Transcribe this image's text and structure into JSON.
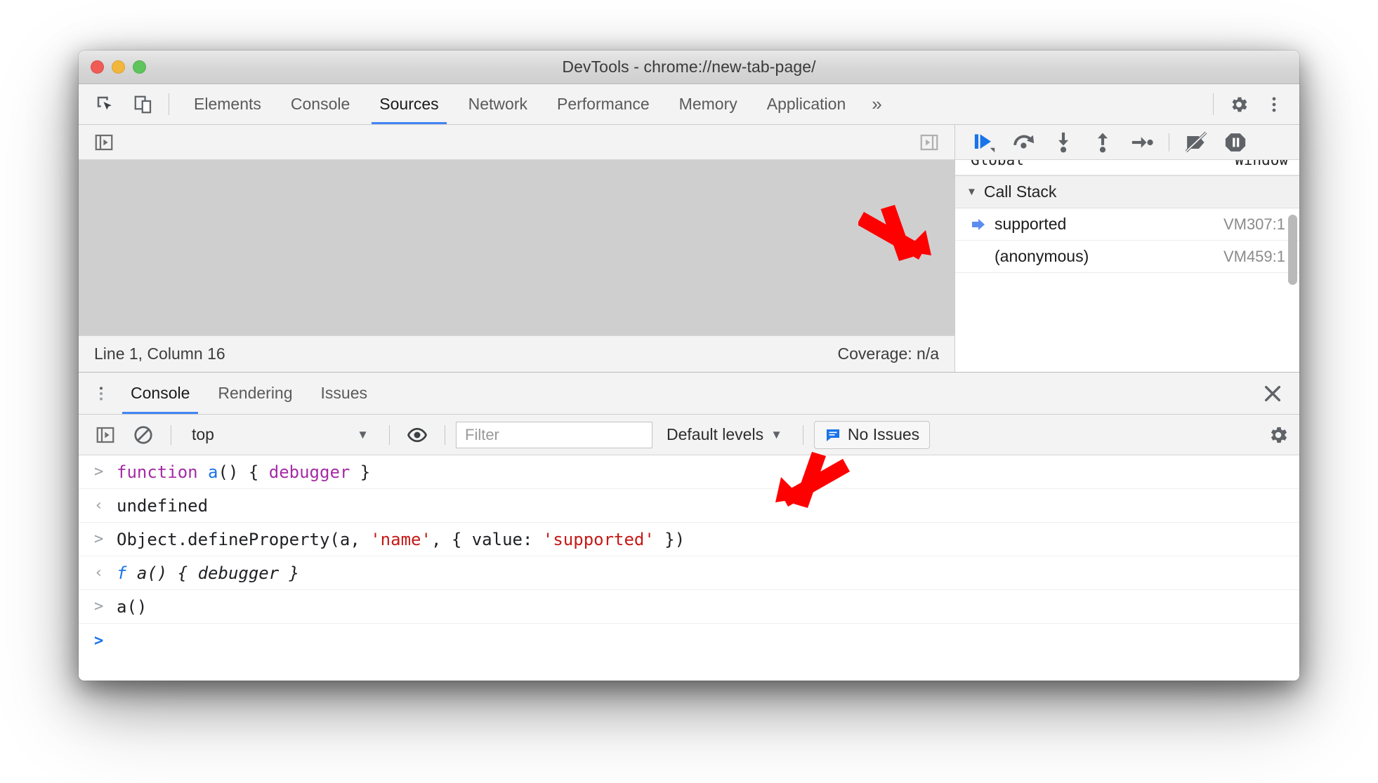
{
  "window": {
    "title": "DevTools - chrome://new-tab-page/",
    "traffic_lights": [
      "close-red",
      "minimize-yellow",
      "maximize-green"
    ]
  },
  "main_tabs": {
    "icons": [
      "inspect-element-icon",
      "device-toolbar-icon"
    ],
    "items": [
      {
        "label": "Elements",
        "active": false
      },
      {
        "label": "Console",
        "active": false
      },
      {
        "label": "Sources",
        "active": true
      },
      {
        "label": "Network",
        "active": false
      },
      {
        "label": "Performance",
        "active": false
      },
      {
        "label": "Memory",
        "active": false
      },
      {
        "label": "Application",
        "active": false
      }
    ],
    "more_label": "»",
    "settings_icon": "gear-icon",
    "menu_icon": "kebab-menu-icon"
  },
  "sources": {
    "toolbar": {
      "show_navigator_icon": "show-navigator-panel-icon",
      "show_debugger_icon": "show-debugger-panel-icon"
    },
    "status": {
      "cursor": "Line 1, Column 16",
      "coverage": "Coverage: n/a"
    }
  },
  "debugger": {
    "buttons": [
      {
        "name": "resume-script-execution",
        "active": true
      },
      {
        "name": "step-over-next-function-call",
        "active": false
      },
      {
        "name": "step-into-next-function-call",
        "active": false
      },
      {
        "name": "step-out-of-current-function",
        "active": false
      },
      {
        "name": "step",
        "active": false
      },
      {
        "name": "deactivate-breakpoints",
        "active": false
      },
      {
        "name": "pause-on-exceptions",
        "active": false
      }
    ],
    "scope_clipped": {
      "left": "Global",
      "right": "Window"
    },
    "call_stack": {
      "title": "Call Stack",
      "expanded": true,
      "frames": [
        {
          "name": "supported",
          "location": "VM307:1",
          "current": true
        },
        {
          "name": "(anonymous)",
          "location": "VM459:1",
          "current": false
        }
      ]
    }
  },
  "drawer": {
    "tabs": [
      {
        "label": "Console",
        "active": true
      },
      {
        "label": "Rendering",
        "active": false
      },
      {
        "label": "Issues",
        "active": false
      }
    ],
    "menu_icon": "kebab-menu-icon",
    "close_icon": "close-icon",
    "console_toolbar": {
      "sidebar_icon": "console-sidebar-icon",
      "clear_icon": "clear-console-icon",
      "context_value": "top",
      "context_caret": "▼",
      "eye_icon": "live-expression-eye-icon",
      "filter_placeholder": "Filter",
      "filter_value": "",
      "levels_label": "Default levels",
      "levels_caret": "▼",
      "issues_icon": "issues-message-icon",
      "issues_label": "No Issues",
      "settings_icon": "gear-icon"
    },
    "console_lines": [
      {
        "kind": "input",
        "gutter": ">",
        "tokens": [
          {
            "t": "function",
            "c": "kw"
          },
          {
            "t": " ",
            "c": "plain"
          },
          {
            "t": "a",
            "c": "ident"
          },
          {
            "t": "() { ",
            "c": "plain"
          },
          {
            "t": "debugger",
            "c": "kw"
          },
          {
            "t": " }",
            "c": "plain"
          }
        ]
      },
      {
        "kind": "output",
        "gutter": "‹",
        "tokens": [
          {
            "t": "undefined",
            "c": "plain"
          }
        ]
      },
      {
        "kind": "input",
        "gutter": ">",
        "tokens": [
          {
            "t": "Object.defineProperty(a, ",
            "c": "plain"
          },
          {
            "t": "'name'",
            "c": "str"
          },
          {
            "t": ", { value: ",
            "c": "plain"
          },
          {
            "t": "'supported'",
            "c": "str"
          },
          {
            "t": " })",
            "c": "plain"
          }
        ]
      },
      {
        "kind": "output",
        "gutter": "‹",
        "tokens": [
          {
            "t": "f",
            "c": "f-glyph"
          },
          {
            "t": " a() { debugger }",
            "c": "fn-italic"
          }
        ]
      },
      {
        "kind": "input",
        "gutter": ">",
        "tokens": [
          {
            "t": "a()",
            "c": "plain"
          }
        ]
      },
      {
        "kind": "prompt",
        "gutter": ">",
        "tokens": []
      }
    ]
  },
  "annotations": {
    "color": "#ff0000",
    "arrows": [
      {
        "name": "arrow-to-call-stack-frame",
        "direction": "down-right"
      },
      {
        "name": "arrow-to-define-property-line",
        "direction": "down-left"
      }
    ]
  }
}
